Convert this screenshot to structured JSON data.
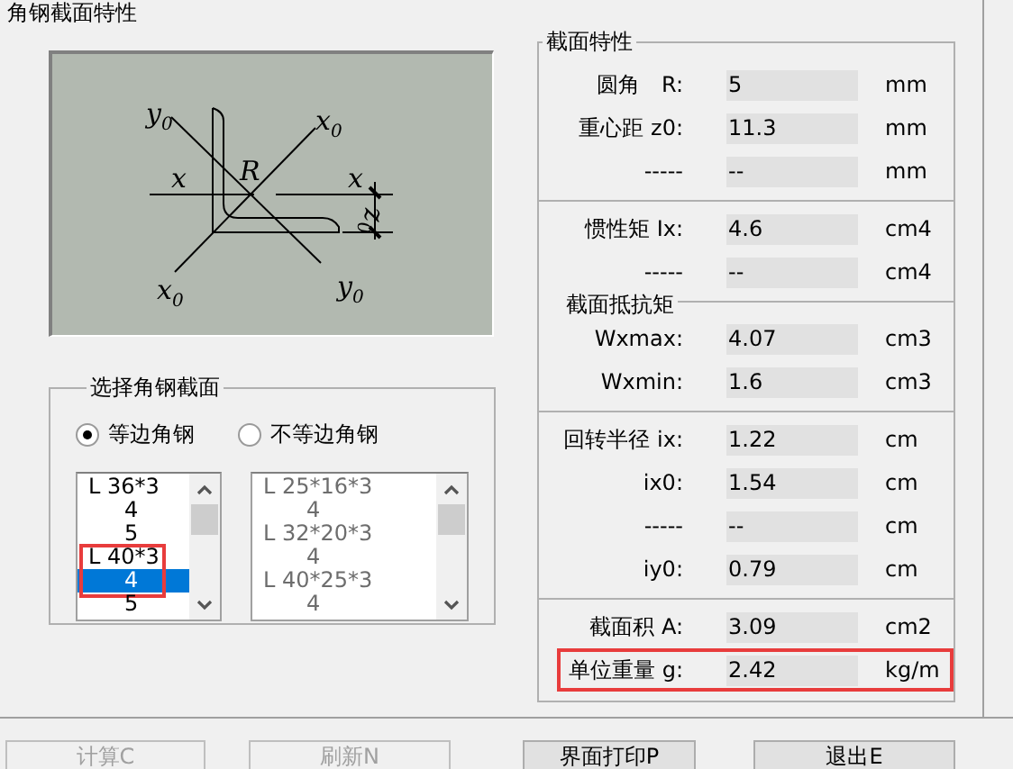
{
  "window": {
    "title": "角钢截面特性"
  },
  "diagram": {
    "labels": [
      {
        "text": "y$_{0}$"
      },
      {
        "text": "x$_{0}$"
      },
      {
        "text": "x"
      },
      {
        "text": "R"
      },
      {
        "text": "x"
      },
      {
        "text": "z$_{0}$",
        "rotated": true
      },
      {
        "text": "x$_{0}$"
      },
      {
        "text": "y$_{0}$"
      }
    ]
  },
  "selection": {
    "title": "选择角钢截面",
    "radios": [
      {
        "label": "等边角钢",
        "selected": true
      },
      {
        "label": "不等边角钢",
        "selected": false
      }
    ],
    "lists": [
      {
        "disabled": false,
        "items": [
          {
            "text": "L 36*3",
            "kind": "size",
            "selected": false,
            "highlighted": false
          },
          {
            "text": "4",
            "kind": "thickness",
            "selected": false,
            "highlighted": false
          },
          {
            "text": "5",
            "kind": "thickness",
            "selected": false,
            "highlighted": false
          },
          {
            "text": "L 40*3",
            "kind": "size",
            "selected": false,
            "highlighted": true
          },
          {
            "text": "4",
            "kind": "thickness",
            "selected": true,
            "highlighted": true
          },
          {
            "text": "5",
            "kind": "thickness",
            "selected": false,
            "highlighted": false
          }
        ]
      },
      {
        "disabled": true,
        "items": [
          {
            "text": "L 25*16*3",
            "kind": "size",
            "selected": false,
            "highlighted": false
          },
          {
            "text": "4",
            "kind": "thickness",
            "selected": false,
            "highlighted": false
          },
          {
            "text": "L 32*20*3",
            "kind": "size",
            "selected": false,
            "highlighted": false
          },
          {
            "text": "4",
            "kind": "thickness",
            "selected": false,
            "highlighted": false
          },
          {
            "text": "L 40*25*3",
            "kind": "size",
            "selected": false,
            "highlighted": false
          },
          {
            "text": "4",
            "kind": "thickness",
            "selected": false,
            "highlighted": false
          }
        ]
      }
    ]
  },
  "properties": {
    "title": "截面特性",
    "sections": [
      {
        "rows": [
          {
            "label": "圆角　R:",
            "value": "5",
            "unit": "mm",
            "highlighted": false
          },
          {
            "label": "重心距 z0:",
            "value": "11.3",
            "unit": "mm",
            "highlighted": false
          },
          {
            "label": "-----",
            "value": "--",
            "unit": "mm",
            "highlighted": false
          }
        ]
      },
      {
        "rows": [
          {
            "label": "惯性矩 Ix:",
            "value": "4.6",
            "unit": "cm4",
            "highlighted": false
          },
          {
            "label": "-----",
            "value": "--",
            "unit": "cm4",
            "highlighted": false
          }
        ]
      },
      {
        "title": "截面抵抗矩",
        "rows": [
          {
            "label": "Wxmax:",
            "value": "4.07",
            "unit": "cm3",
            "highlighted": false
          },
          {
            "label": "Wxmin:",
            "value": "1.6",
            "unit": "cm3",
            "highlighted": false
          }
        ]
      },
      {
        "rows": [
          {
            "label": "回转半径 ix:",
            "value": "1.22",
            "unit": "cm",
            "highlighted": false
          },
          {
            "label": "ix0:",
            "value": "1.54",
            "unit": "cm",
            "highlighted": false
          },
          {
            "label": "-----",
            "value": "--",
            "unit": "cm",
            "highlighted": false
          },
          {
            "label": "iy0:",
            "value": "0.79",
            "unit": "cm",
            "highlighted": false
          }
        ]
      },
      {
        "rows": [
          {
            "label": "截面积 A:",
            "value": "3.09",
            "unit": "cm2",
            "highlighted": false
          },
          {
            "label": "单位重量 g:",
            "value": "2.42",
            "unit": "kg/m",
            "highlighted": true
          }
        ]
      }
    ]
  },
  "buttons": [
    {
      "label": "计算C",
      "disabled": true
    },
    {
      "label": "刷新N",
      "disabled": true
    },
    {
      "label": "界面打印P",
      "disabled": false
    },
    {
      "label": "退出E",
      "disabled": false
    }
  ]
}
